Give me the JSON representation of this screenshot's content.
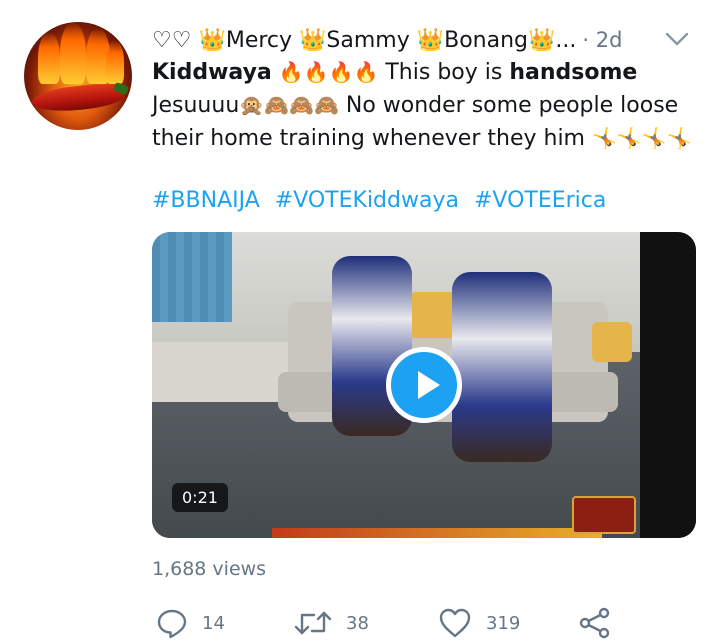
{
  "tweet": {
    "display_name": "♡♡ 👑Mercy 👑Sammy 👑Bonang👑...",
    "timestamp": "· 2d",
    "text": {
      "bold_name": "Kiddwaya",
      "fire_emojis": "🔥🔥🔥🔥",
      "phrase1": " This boy is ",
      "bold_word": "handsome",
      "line2_start": "Jesuuuu",
      "monkey_emojis": "🙊🙈🙈🙈",
      "line2_end": " No wonder some people loose their home training whenever they him ",
      "cartwheel_emojis": "🤸🤸🤸🤸"
    },
    "hashtags": [
      "#BBNAIJA",
      "#VOTEKiddwaya",
      "#VOTEErica"
    ],
    "video": {
      "duration": "0:21"
    },
    "views": "1,688 views",
    "actions": {
      "reply_count": "14",
      "retweet_count": "38",
      "like_count": "319"
    }
  },
  "icons": {
    "avatar": "chili-flame-avatar",
    "caret": "chevron-down-icon",
    "play": "play-icon",
    "reply": "reply-icon",
    "retweet": "retweet-icon",
    "like": "heart-icon",
    "share": "share-icon"
  },
  "colors": {
    "accent": "#1da1f2",
    "muted": "#657786",
    "text": "#14171a"
  }
}
